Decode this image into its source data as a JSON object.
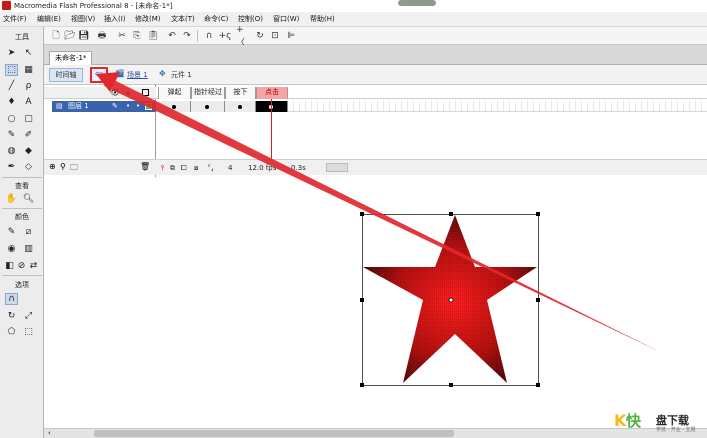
{
  "window": {
    "title": "Macromedia Flash Professional 8 - [未命名-1*]"
  },
  "menubar": {
    "items": [
      "文件(F)",
      "编辑(E)",
      "视图(V)",
      "插入(I)",
      "修改(M)",
      "文本(T)",
      "命令(C)",
      "控制(O)",
      "窗口(W)",
      "帮助(H)"
    ]
  },
  "tools_panel": {
    "tools_label": "工具",
    "view_label": "查看",
    "colors_label": "颜色",
    "options_label": "选项"
  },
  "document": {
    "tab_label": "未命名-1*"
  },
  "editbar": {
    "timeline_label": "时间轴",
    "scene_label": "场景 1",
    "symbol_label": "元件 1"
  },
  "timeline": {
    "layer_name": "图层 1",
    "button_states": [
      "弹起",
      "指针经过",
      "按下",
      "点击"
    ],
    "active_state": "点击",
    "current_frame": "4",
    "fps": "12.0 fps",
    "elapsed": "0.3s"
  },
  "watermark": {
    "k": "K",
    "kuai": "快",
    "brand": "盘下载",
    "slogan": "学技 · 开业 · 主题"
  },
  "colors": {
    "annotation_red": "#e0282e",
    "star_center": "#f01818",
    "star_edge": "#3a0808",
    "selected_layer": "#3a63ad"
  }
}
